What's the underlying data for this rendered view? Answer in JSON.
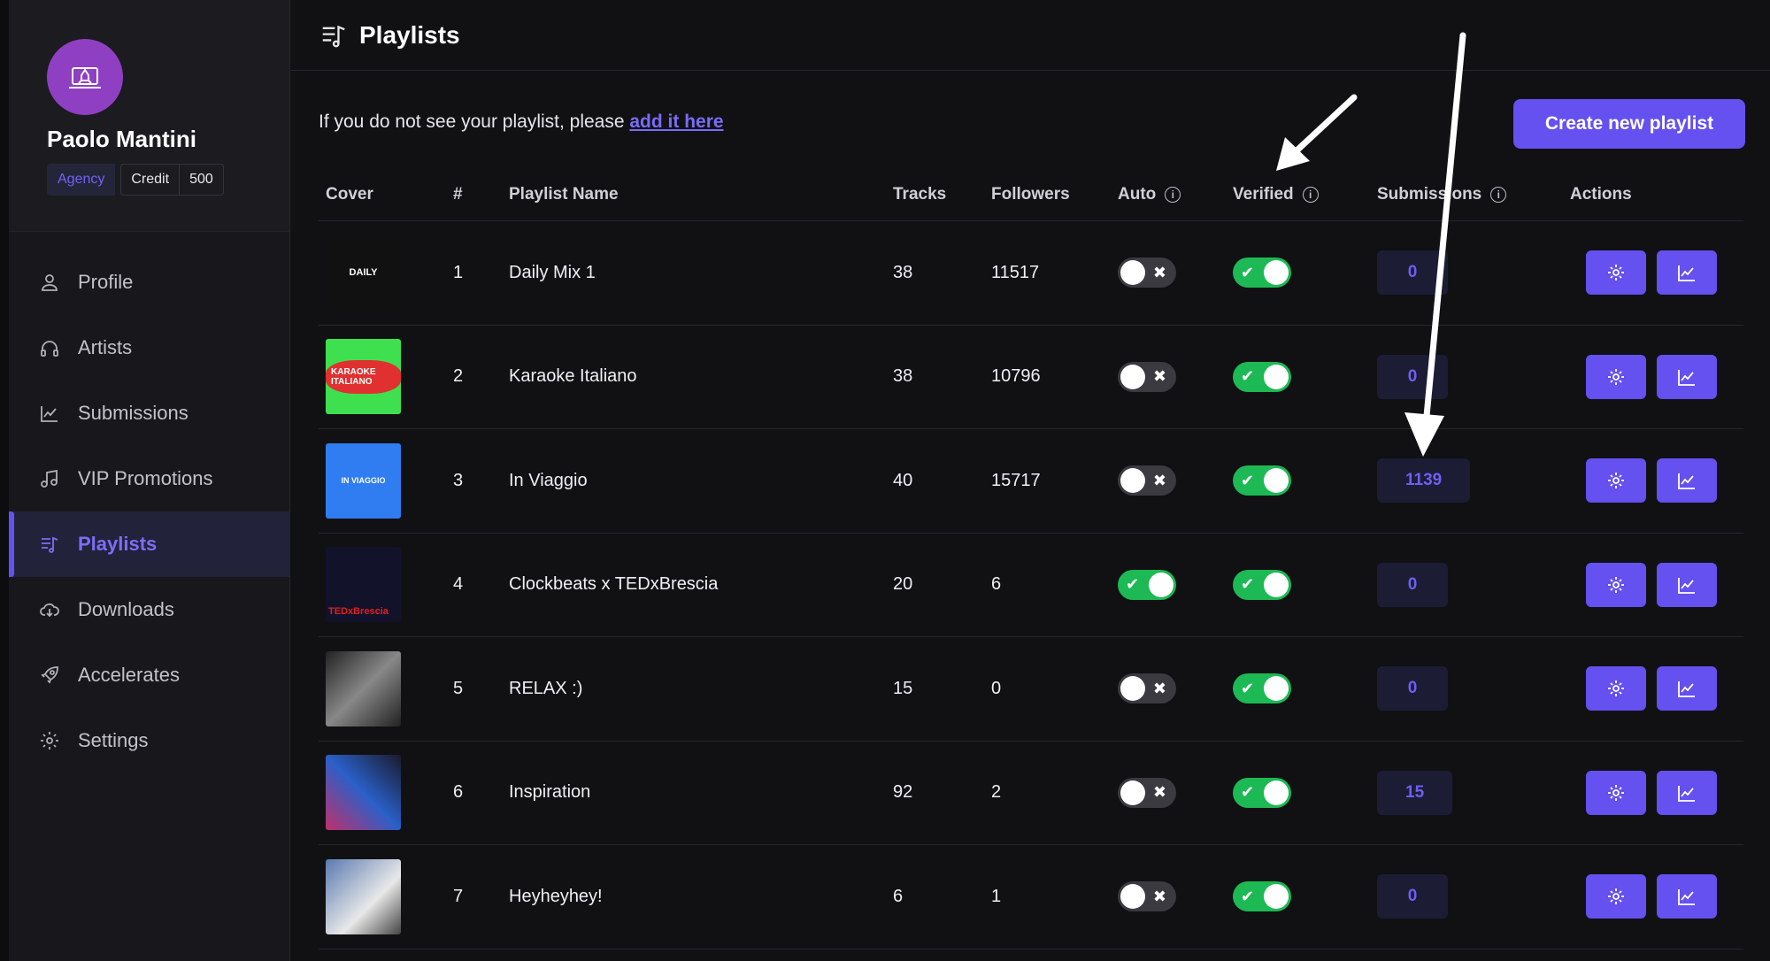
{
  "user": {
    "name": "Paolo Mantini",
    "role_badge": "Agency",
    "credit_label": "Credit",
    "credit_value": "500"
  },
  "nav": [
    {
      "label": "Profile",
      "icon": "user-icon",
      "active": false
    },
    {
      "label": "Artists",
      "icon": "headphones-icon",
      "active": false
    },
    {
      "label": "Submissions",
      "icon": "chart-icon",
      "active": false
    },
    {
      "label": "VIP Promotions",
      "icon": "music-note-icon",
      "active": false
    },
    {
      "label": "Playlists",
      "icon": "playlist-icon",
      "active": true
    },
    {
      "label": "Downloads",
      "icon": "cloud-download-icon",
      "active": false
    },
    {
      "label": "Accelerates",
      "icon": "rocket-icon",
      "active": false
    },
    {
      "label": "Settings",
      "icon": "gear-icon",
      "active": false
    }
  ],
  "header": {
    "title": "Playlists"
  },
  "notice": {
    "text": "If you do not see your playlist, please ",
    "link": "add it here"
  },
  "create_button": "Create new playlist",
  "table": {
    "columns": {
      "cover": "Cover",
      "num": "#",
      "name": "Playlist Name",
      "tracks": "Tracks",
      "followers": "Followers",
      "auto": "Auto",
      "verified": "Verified",
      "submissions": "Submissions",
      "actions": "Actions"
    },
    "rows": [
      {
        "num": "1",
        "name": "Daily Mix 1",
        "tracks": "38",
        "followers": "11517",
        "auto": false,
        "verified": true,
        "submissions": "0",
        "cover_text": "DAILY"
      },
      {
        "num": "2",
        "name": "Karaoke Italiano",
        "tracks": "38",
        "followers": "10796",
        "auto": false,
        "verified": true,
        "submissions": "0",
        "cover_text": "KARAOKE ITALIANO"
      },
      {
        "num": "3",
        "name": "In Viaggio",
        "tracks": "40",
        "followers": "15717",
        "auto": false,
        "verified": true,
        "submissions": "1139",
        "cover_text": "IN VIAGGIO"
      },
      {
        "num": "4",
        "name": "Clockbeats x TEDxBrescia",
        "tracks": "20",
        "followers": "6",
        "auto": true,
        "verified": true,
        "submissions": "0",
        "cover_text": "TEDxBrescia"
      },
      {
        "num": "5",
        "name": "RELAX :)",
        "tracks": "15",
        "followers": "0",
        "auto": false,
        "verified": true,
        "submissions": "0",
        "cover_text": ""
      },
      {
        "num": "6",
        "name": "Inspiration",
        "tracks": "92",
        "followers": "2",
        "auto": false,
        "verified": true,
        "submissions": "15",
        "cover_text": ""
      },
      {
        "num": "7",
        "name": "Heyheyhey!",
        "tracks": "6",
        "followers": "1",
        "auto": false,
        "verified": true,
        "submissions": "0",
        "cover_text": ""
      }
    ]
  },
  "colors": {
    "accent": "#6550f0",
    "toggle_on": "#1db954",
    "toggle_off": "#3a3a40",
    "sub_text": "#6d5ff3"
  }
}
